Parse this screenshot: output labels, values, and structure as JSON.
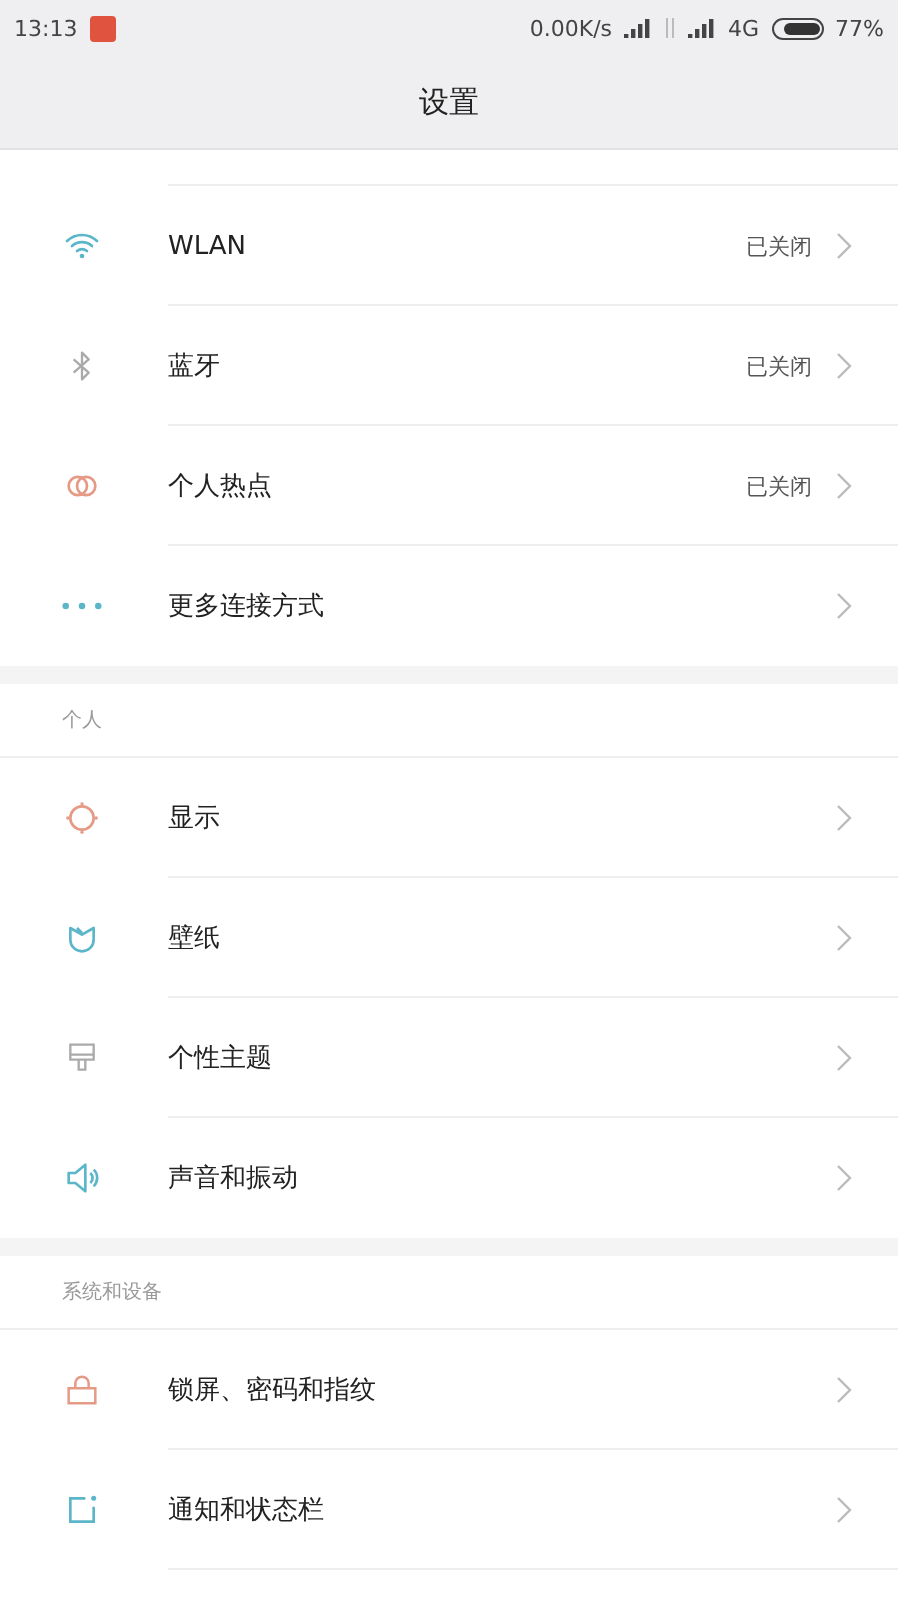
{
  "status_bar": {
    "time": "13:13",
    "speed": "0.00K/s",
    "network": "4G",
    "battery": "77%"
  },
  "header": {
    "title": "设置"
  },
  "sections": [
    {
      "items": [
        {
          "label": "WLAN",
          "status": "已关闭"
        },
        {
          "label": "蓝牙",
          "status": "已关闭"
        },
        {
          "label": "个人热点",
          "status": "已关闭"
        },
        {
          "label": "更多连接方式"
        }
      ]
    },
    {
      "title": "个人",
      "items": [
        {
          "label": "显示"
        },
        {
          "label": "壁纸"
        },
        {
          "label": "个性主题"
        },
        {
          "label": "声音和振动"
        }
      ]
    },
    {
      "title": "系统和设备",
      "items": [
        {
          "label": "锁屏、密码和指纹"
        },
        {
          "label": "通知和状态栏"
        }
      ]
    }
  ]
}
